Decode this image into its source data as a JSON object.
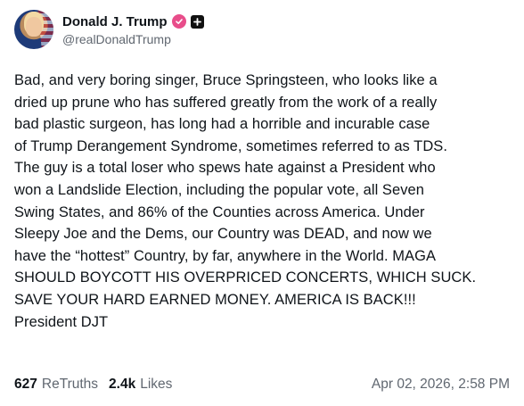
{
  "author": {
    "display_name": "Donald J. Trump",
    "handle": "@realDonaldTrump",
    "verified_icon": "verified-badge-icon",
    "plus_icon": "plus-square-icon"
  },
  "post": {
    "text": "Bad, and very boring singer, Bruce Springsteen, who looks like a\ndried up prune who has suffered greatly from the work of a really\nbad plastic surgeon, has long had a horrible and incurable case\nof Trump Derangement Syndrome, sometimes referred to as TDS.\nThe guy is a total loser who spews hate against a President who\nwon a Landslide Election, including the popular vote, all Seven\nSwing States, and 86% of the Counties across America. Under\nSleepy Joe and the Dems, our Country was DEAD, and now we\nhave the “hottest” Country, by far, anywhere in the World. MAGA\nSHOULD BOYCOTT HIS OVERPRICED CONCERTS, WHICH SUCK.\nSAVE YOUR HARD EARNED MONEY. AMERICA IS BACK!!!\nPresident DJT"
  },
  "stats": {
    "retruths_count": "627",
    "retruths_label": "ReTruths",
    "likes_count": "2.4k",
    "likes_label": "Likes"
  },
  "timestamp": "Apr 02, 2026, 2:58 PM",
  "colors": {
    "verified": "#e84d8a",
    "muted_text": "#606770",
    "text": "#0f1419"
  }
}
